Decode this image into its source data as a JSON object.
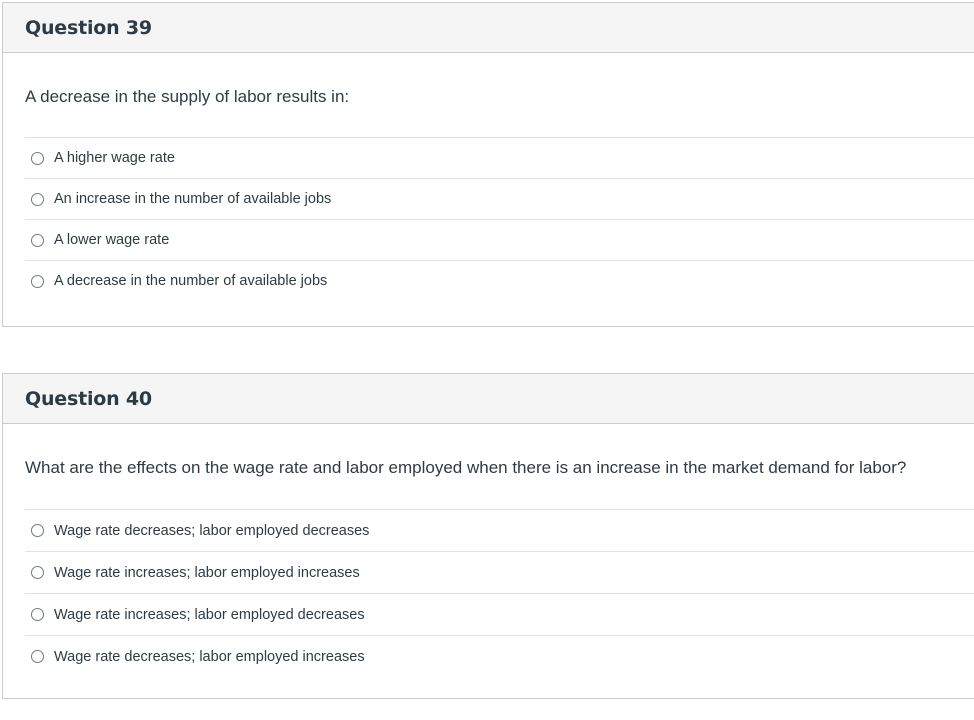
{
  "questions": [
    {
      "title": "Question 39",
      "text": "A decrease in the supply of labor results in:",
      "answers": [
        "A higher wage rate",
        "An increase in the number of available jobs",
        "A lower wage rate",
        "A decrease in the number of available jobs"
      ]
    },
    {
      "title": "Question 40",
      "text": "What are the effects on the wage rate and labor employed when there is an increase in the market demand for labor?",
      "answers": [
        "Wage rate decreases; labor employed decreases",
        "Wage rate increases; labor employed increases",
        "Wage rate increases; labor employed decreases",
        "Wage rate decreases; labor employed increases"
      ]
    }
  ]
}
